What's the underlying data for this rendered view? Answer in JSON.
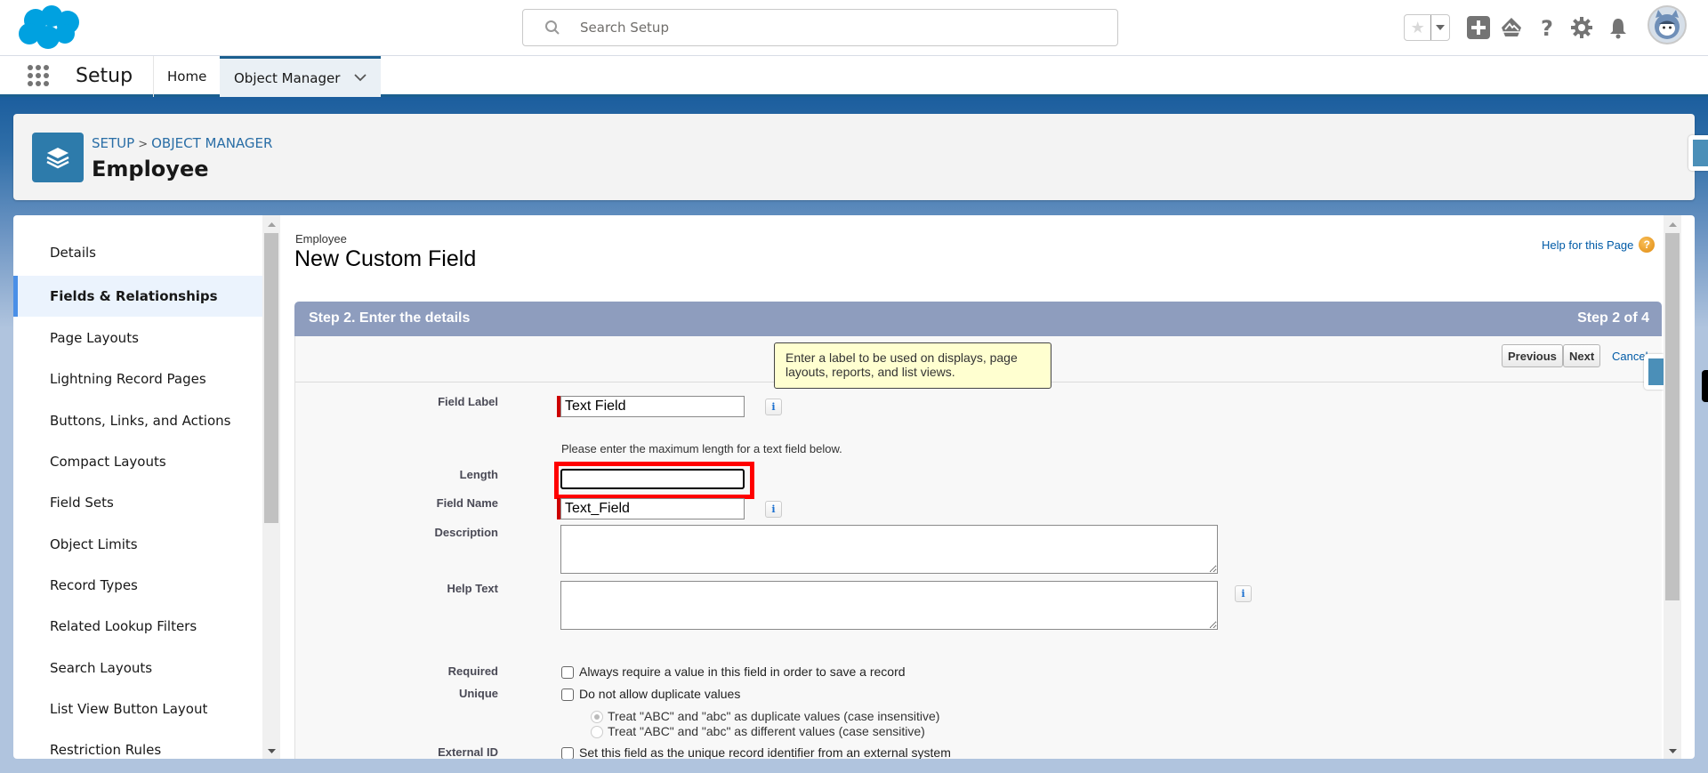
{
  "header": {
    "search_placeholder": "Search Setup",
    "icons": [
      "salesforce-cloud-logo",
      "search-icon",
      "favorite-star-icon",
      "favorites-dropdown-icon",
      "global-actions-plus-icon",
      "trailhead-icon",
      "help-icon",
      "setup-gear-icon",
      "notifications-bell-icon",
      "user-avatar"
    ]
  },
  "nav": {
    "app_name": "Setup",
    "tabs": [
      {
        "label": "Home",
        "active": false
      },
      {
        "label": "Object Manager",
        "active": true
      }
    ]
  },
  "object_header": {
    "breadcrumb": [
      "SETUP",
      "OBJECT MANAGER"
    ],
    "breadcrumb_separator": ">",
    "title": "Employee",
    "icon": "layers-icon"
  },
  "sidebar": {
    "items": [
      {
        "label": "Details",
        "active": false
      },
      {
        "label": "Fields & Relationships",
        "active": true
      },
      {
        "label": "Page Layouts",
        "active": false
      },
      {
        "label": "Lightning Record Pages",
        "active": false
      },
      {
        "label": "Buttons, Links, and Actions",
        "active": false
      },
      {
        "label": "Compact Layouts",
        "active": false
      },
      {
        "label": "Field Sets",
        "active": false
      },
      {
        "label": "Object Limits",
        "active": false
      },
      {
        "label": "Record Types",
        "active": false
      },
      {
        "label": "Related Lookup Filters",
        "active": false
      },
      {
        "label": "Search Layouts",
        "active": false
      },
      {
        "label": "List View Button Layout",
        "active": false
      },
      {
        "label": "Restriction Rules",
        "active": false
      }
    ]
  },
  "main": {
    "object_label": "Employee",
    "page_title": "New Custom Field",
    "help_link": "Help for this Page",
    "step_title": "Step 2. Enter the details",
    "step_counter": "Step 2 of 4",
    "buttons": {
      "previous": "Previous",
      "next": "Next",
      "cancel": "Cancel"
    },
    "tooltip": "Enter a label to be used on displays, page layouts, reports, and list views.",
    "form": {
      "field_label": {
        "label": "Field Label",
        "value": "Text Field"
      },
      "length_hint": "Please enter the maximum length for a text field below.",
      "length": {
        "label": "Length",
        "value": ""
      },
      "field_name": {
        "label": "Field Name",
        "value": "Text_Field"
      },
      "description": {
        "label": "Description",
        "value": ""
      },
      "help_text": {
        "label": "Help Text",
        "value": ""
      },
      "required": {
        "label": "Required",
        "text": "Always require a value in this field in order to save a record",
        "checked": false
      },
      "unique": {
        "label": "Unique",
        "text": "Do not allow duplicate values",
        "checked": false
      },
      "case_options": [
        {
          "text": "Treat \"ABC\" and \"abc\" as duplicate values (case insensitive)",
          "selected": true
        },
        {
          "text": "Treat \"ABC\" and \"abc\" as different values (case sensitive)",
          "selected": false
        }
      ],
      "external_id": {
        "label": "External ID",
        "text": "Set this field as the unique record identifier from an external system",
        "checked": false
      }
    }
  },
  "colors": {
    "brand_blue": "#00a1e0",
    "nav_accent": "#1b5f8f",
    "step_bar": "#8e9dbe",
    "required_marker": "#cc0000",
    "highlight_box": "#ff0000",
    "tooltip_bg": "#ffffd0",
    "sidebar_active_bg": "#ebf3fd",
    "sidebar_active_bar": "#4a8fe7"
  }
}
